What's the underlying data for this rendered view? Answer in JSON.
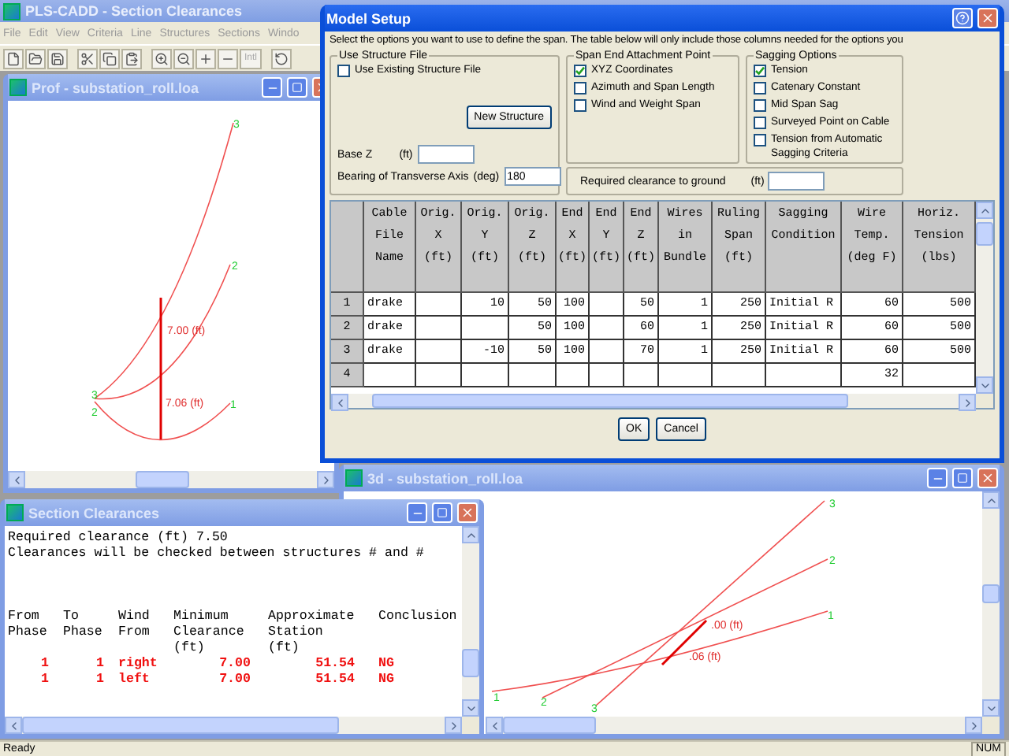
{
  "app": {
    "title": "PLS-CADD - Section Clearances",
    "menu": [
      "File",
      "Edit",
      "View",
      "Criteria",
      "Line",
      "Structures",
      "Sections",
      "Windo"
    ],
    "toolbar_text_button": "Intl",
    "status": "Ready",
    "indicator": "NUM"
  },
  "profile_window": {
    "title": "Prof - substation_roll.loa",
    "clearance_labels": [
      "7.00 (ft)",
      "7.06 (ft)"
    ],
    "phase_labels": [
      "3",
      "2",
      "1",
      "3",
      "2"
    ]
  },
  "view_3d_window": {
    "title": "3d - substation_roll.loa",
    "clearance_labels": [
      ".00 (ft)",
      ".06 (ft)"
    ],
    "phase_labels": [
      "3",
      "2",
      "1",
      "1",
      "2",
      "3"
    ]
  },
  "clearances_window": {
    "title": "Section Clearances",
    "lines": [
      "Required clearance (ft) 7.50",
      "Clearances will be checked between structures # and #"
    ],
    "columns": [
      "From\nPhase",
      "To\nPhase",
      "Wind\nFrom",
      "Minimum\nClearance\n(ft)",
      "Approximate\nStation\n(ft)",
      "Conclusion"
    ],
    "rows": [
      {
        "cells": [
          "1",
          "1",
          "right",
          "7.00",
          "51.54",
          "NG"
        ],
        "failed": true
      },
      {
        "cells": [
          "1",
          "1",
          "left",
          "7.00",
          "51.54",
          "NG"
        ],
        "failed": true
      }
    ]
  },
  "dialog": {
    "title": "Model Setup",
    "instruction": "Select the options you want to use to define the span.  The table below will only include those columns needed for the options you",
    "structure_group": {
      "label": "Use Structure File",
      "checkbox": {
        "label": "Use Existing Structure File",
        "checked": false
      },
      "button": "New Structure",
      "base_z": {
        "label": "Base Z",
        "unit": "(ft)"
      },
      "bearing": {
        "label": "Bearing of Transverse Axis",
        "unit": "(deg)",
        "value": "180"
      }
    },
    "attachment_group": {
      "label": "Span End Attachment Point",
      "options": [
        {
          "label": "XYZ Coordinates",
          "checked": true
        },
        {
          "label": "Azimuth and Span Length",
          "checked": false
        },
        {
          "label": "Wind and Weight Span",
          "checked": false
        }
      ]
    },
    "sagging_group": {
      "label": "Sagging Options",
      "options": [
        {
          "label": "Tension",
          "checked": true
        },
        {
          "label": "Catenary Constant",
          "checked": false
        },
        {
          "label": "Mid Span Sag",
          "checked": false
        },
        {
          "label": "Surveyed Point on Cable",
          "checked": false
        },
        {
          "label": "Tension from Automatic Sagging Criteria",
          "checked": false
        }
      ]
    },
    "clearance_field": {
      "label": "Required clearance to ground",
      "unit": "(ft)"
    },
    "table": {
      "columns": [
        "Cable\nFile\nName",
        "Orig.\nX\n(ft)",
        "Orig.\nY\n(ft)",
        "Orig.\nZ\n(ft)",
        "End\nX\n(ft)",
        "End\nY\n(ft)",
        "End\nZ\n(ft)",
        "Wires\nin\nBundle",
        "Ruling\nSpan\n(ft)",
        "Sagging\nCondition",
        "Wire\nTemp.\n(deg F)",
        "Horiz.\nTension\n(lbs)"
      ],
      "rows": [
        {
          "header": "1",
          "cells": [
            "drake",
            null,
            "10",
            "50",
            "100",
            null,
            "50",
            "1",
            "250",
            "Initial R",
            "60",
            "500"
          ]
        },
        {
          "header": "2",
          "cells": [
            "drake",
            null,
            null,
            "50",
            "100",
            null,
            "60",
            "1",
            "250",
            "Initial R",
            "60",
            "500"
          ]
        },
        {
          "header": "3",
          "cells": [
            "drake",
            null,
            "-10",
            "50",
            "100",
            null,
            "70",
            "1",
            "250",
            "Initial R",
            "60",
            "500"
          ]
        },
        {
          "header": "4",
          "cells": [
            null,
            null,
            null,
            null,
            null,
            null,
            null,
            null,
            null,
            null,
            "32",
            null
          ]
        }
      ]
    },
    "buttons": [
      "OK",
      "Cancel"
    ]
  }
}
